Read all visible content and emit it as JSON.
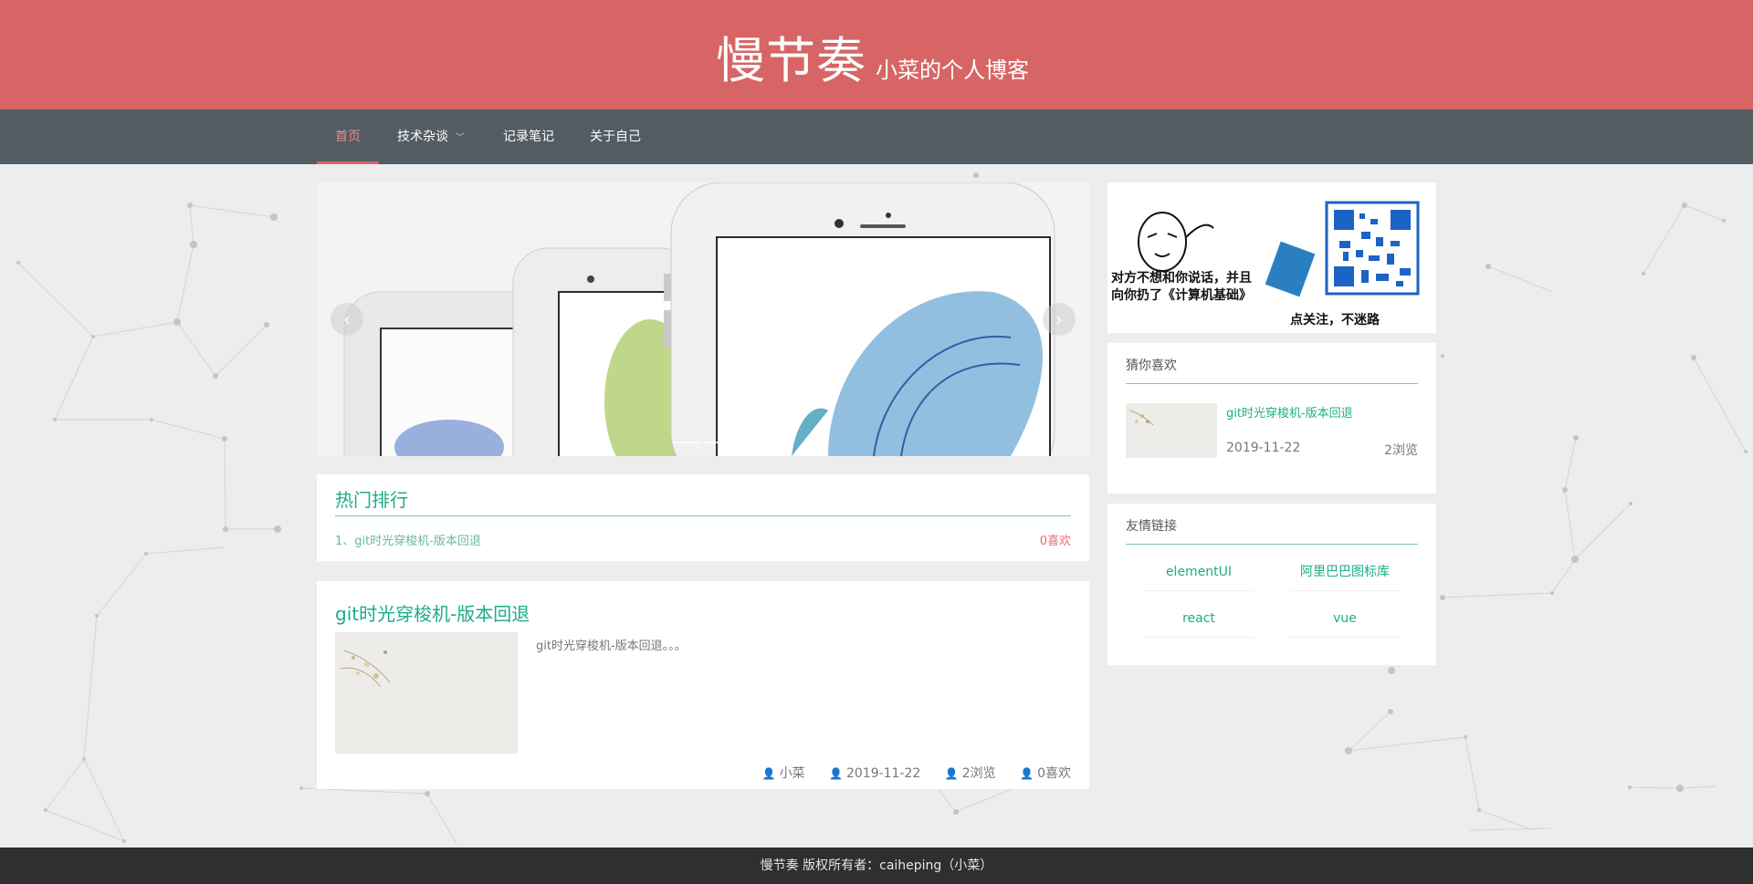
{
  "site": {
    "title": "慢节奏",
    "subtitle": "小菜的个人博客"
  },
  "nav": {
    "items": [
      {
        "label": "首页",
        "active": true
      },
      {
        "label": "技术杂谈",
        "has_dropdown": true
      },
      {
        "label": "记录笔记"
      },
      {
        "label": "关于自己"
      }
    ]
  },
  "carousel": {
    "prev_icon": "‹",
    "next_icon": "›"
  },
  "hot": {
    "title": "热门排行",
    "items": [
      {
        "label": "1、git时光穿梭机-版本回退",
        "likes": "0喜欢"
      }
    ]
  },
  "post": {
    "title": "git时光穿梭机-版本回退",
    "excerpt": "git时光穿梭机-版本回退。。。",
    "author": "小菜",
    "date": "2019-11-22",
    "views": "2浏览",
    "likes": "0喜欢"
  },
  "promo": {
    "line1": "对方不想和你说话，并且",
    "line2": "向你扔了《计算机基础》",
    "caption": "点关注，不迷路"
  },
  "guess": {
    "title": "猜你喜欢",
    "item": {
      "title": "git时光穿梭机-版本回退",
      "date": "2019-11-22",
      "views": "2浏览"
    }
  },
  "links": {
    "title": "友情链接",
    "items": [
      "elementUI",
      "阿里巴巴图标库",
      "react",
      "vue"
    ]
  },
  "footer": {
    "text": "慢节奏 版权所有者：caiheping（小菜）"
  },
  "colors": {
    "header": "#d76565",
    "nav": "#535c63",
    "accent": "#1dad87",
    "like": "#e76d6d"
  }
}
